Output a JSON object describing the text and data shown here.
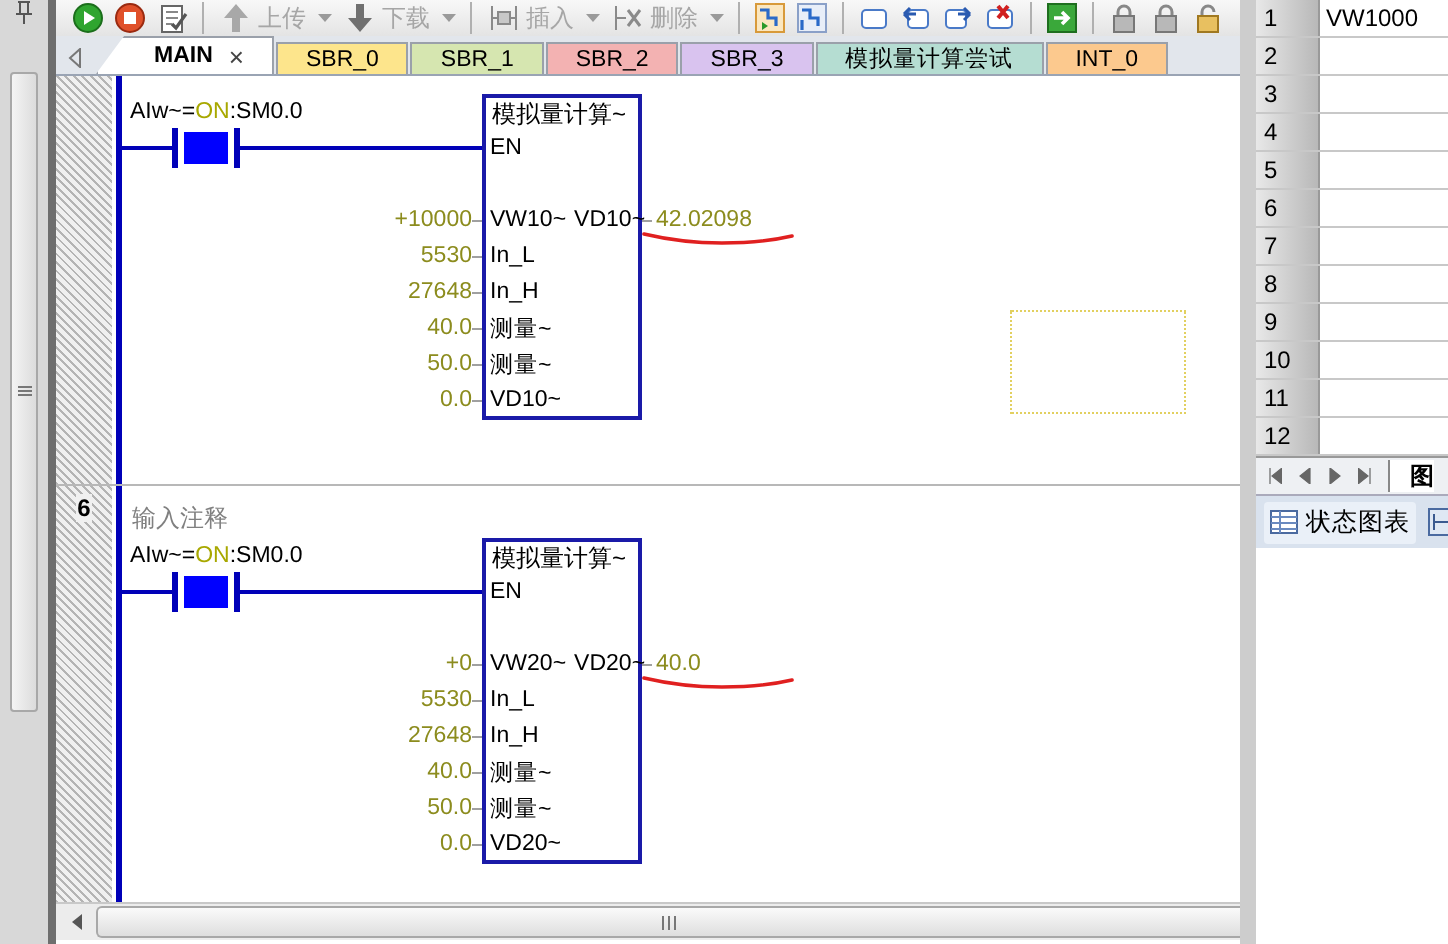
{
  "toolbar": {
    "buttons": [
      {
        "kind": "upload",
        "label": "上传",
        "disabled": true
      },
      {
        "kind": "download",
        "label": "下载",
        "disabled": true
      },
      {
        "kind": "insert",
        "label": "插入",
        "disabled": true
      },
      {
        "kind": "delete",
        "label": "删除",
        "disabled": true
      }
    ]
  },
  "tabs": [
    {
      "label": "MAIN",
      "selected": true,
      "close": "×",
      "color": "#ffffff"
    },
    {
      "label": "SBR_0",
      "selected": false,
      "color": "#fde58c"
    },
    {
      "label": "SBR_1",
      "selected": false,
      "color": "#d6e6b0"
    },
    {
      "label": "SBR_2",
      "selected": false,
      "color": "#f3b2b2"
    },
    {
      "label": "SBR_3",
      "selected": false,
      "color": "#d9c3ef"
    },
    {
      "label": "模拟量计算尝试",
      "selected": false,
      "color": "#b5ddd2"
    },
    {
      "label": "INT_0",
      "selected": false,
      "color": "#fcc98e"
    }
  ],
  "networks": [
    {
      "cursor": true,
      "contact": {
        "energized": true,
        "label_parts": [
          {
            "kind": "symbol",
            "text": "AIw~="
          },
          {
            "kind": "value",
            "text": "ON"
          },
          {
            "kind": "symbol",
            "text": ":SM0.0"
          }
        ]
      },
      "block": {
        "title": "模拟量计算~",
        "en": "EN",
        "rows": [
          {
            "input": "+10000",
            "pin": "VW10~",
            "out_pin": "VD10~",
            "output": "42.02098",
            "marked": true
          },
          {
            "input": "5530",
            "pin": "In_L"
          },
          {
            "input": "27648",
            "pin": "In_H"
          },
          {
            "input": "40.0",
            "pin": "测量~"
          },
          {
            "input": "50.0",
            "pin": "测量~"
          },
          {
            "input": "0.0",
            "pin": "VD10~"
          }
        ]
      }
    },
    {
      "number": "6",
      "comment": "输入注释",
      "contact": {
        "energized": true,
        "label_parts": [
          {
            "kind": "symbol",
            "text": "AIw~="
          },
          {
            "kind": "value",
            "text": "ON"
          },
          {
            "kind": "symbol",
            "text": ":SM0.0"
          }
        ]
      },
      "block": {
        "title": "模拟量计算~",
        "en": "EN",
        "rows": [
          {
            "input": "+0",
            "pin": "VW20~",
            "out_pin": "VD20~",
            "output": "40.0",
            "marked": true
          },
          {
            "input": "5530",
            "pin": "In_L"
          },
          {
            "input": "27648",
            "pin": "In_H"
          },
          {
            "input": "40.0",
            "pin": "测量~"
          },
          {
            "input": "50.0",
            "pin": "测量~"
          },
          {
            "input": "0.0",
            "pin": "VD20~"
          }
        ]
      }
    }
  ],
  "status_chart": {
    "rows": [
      {
        "number": "1",
        "address": "VW1000"
      },
      {
        "number": "2"
      },
      {
        "number": "3"
      },
      {
        "number": "4"
      },
      {
        "number": "5"
      },
      {
        "number": "6"
      },
      {
        "number": "7"
      },
      {
        "number": "8"
      },
      {
        "number": "9"
      },
      {
        "number": "10"
      },
      {
        "number": "11"
      },
      {
        "number": "12"
      }
    ],
    "sheet_tab": "图",
    "view_button": "状态图表"
  }
}
